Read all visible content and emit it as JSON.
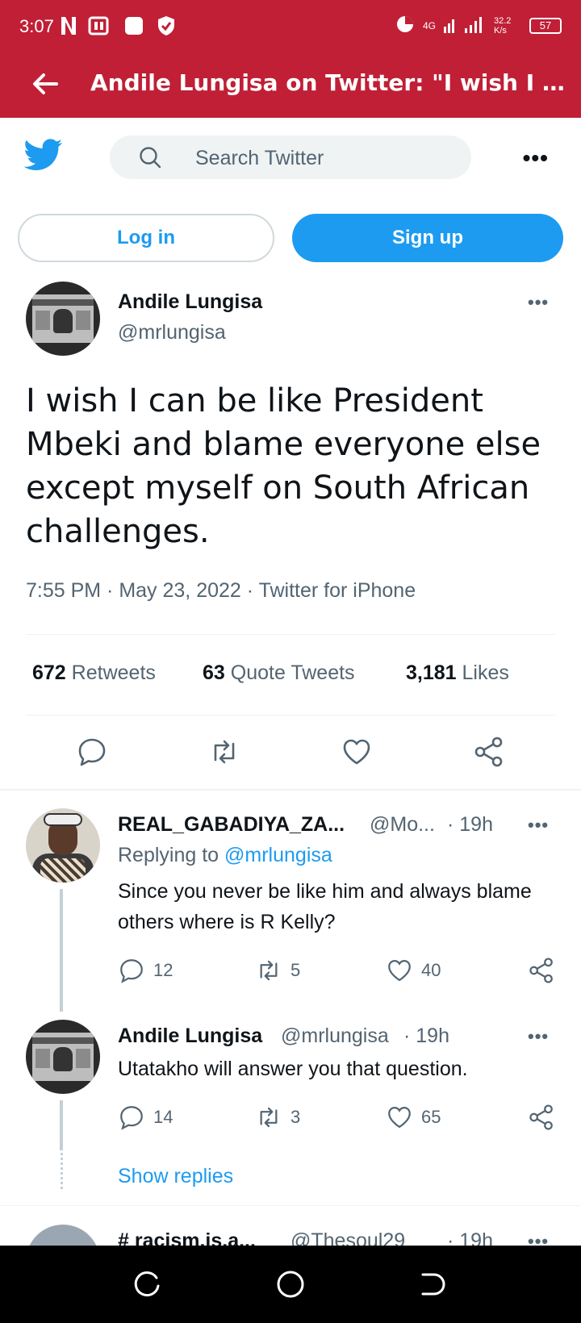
{
  "status_bar": {
    "time": "3:07",
    "network": "4G",
    "speed": "32.2 K/s",
    "battery": "57"
  },
  "browser": {
    "title": "Andile Lungisa on Twitter: \"I wish I can be l..."
  },
  "header": {
    "search_placeholder": "Search Twitter",
    "login_label": "Log in",
    "signup_label": "Sign up"
  },
  "tweet": {
    "name": "Andile Lungisa",
    "handle": "@mrlungisa",
    "text": "I wish I can be like President Mbeki and blame everyone else except myself on South African challenges.",
    "meta": "7:55 PM · May 23, 2022 · Twitter for iPhone",
    "retweets_count": "672",
    "retweets_label": "Retweets",
    "quotes_count": "63",
    "quotes_label": "Quote Tweets",
    "likes_count": "3,181",
    "likes_label": "Likes"
  },
  "replies": [
    {
      "name": "REAL_GABADIYA_ZA...",
      "handle": "@Mo...",
      "time": "· 19h",
      "replying_prefix": "Replying to",
      "replying_to": "@mrlungisa",
      "text": "Since you never be like him and always blame others where is R Kelly?",
      "reply_count": "12",
      "retweet_count": "5",
      "like_count": "40"
    },
    {
      "name": "Andile Lungisa",
      "handle": "@mrlungisa",
      "time": "· 19h",
      "text": "Utatakho will answer you that question.",
      "reply_count": "14",
      "retweet_count": "3",
      "like_count": "65"
    }
  ],
  "show_replies_label": "Show replies",
  "next_reply": {
    "name": "# racism.is.a...",
    "handle": "@Thesoul29",
    "time": "· 19h"
  },
  "colors": {
    "browser_bar": "#c01f36",
    "twitter_blue": "#1d9bf0",
    "muted_text": "#536471"
  }
}
